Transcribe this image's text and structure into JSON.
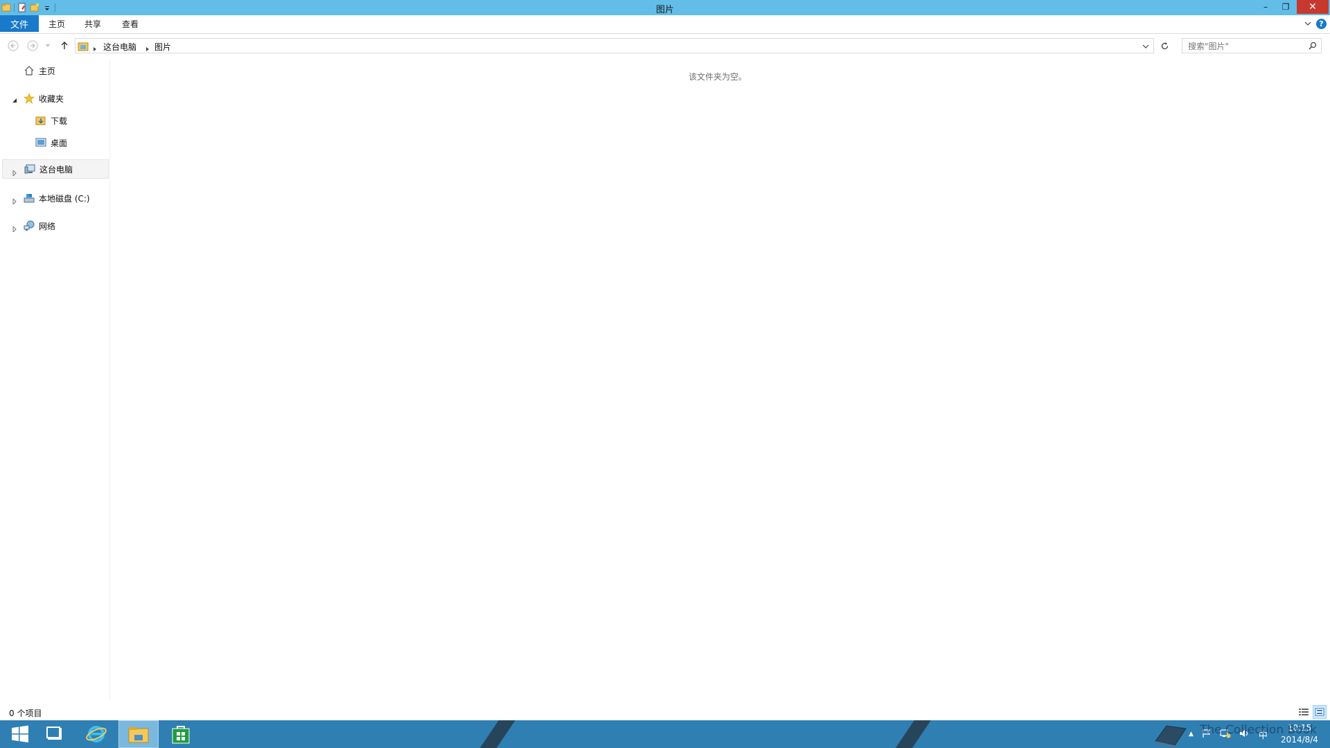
{
  "window": {
    "title": "图片",
    "minimize_glyph": "–",
    "restore_glyph": "❐",
    "close_glyph": "✕"
  },
  "ribbon": {
    "tabs": [
      {
        "label": "文件"
      },
      {
        "label": "主页"
      },
      {
        "label": "共享"
      },
      {
        "label": "查看"
      }
    ],
    "help_glyph": "?"
  },
  "address": {
    "breadcrumbs": [
      "这台电脑",
      "图片"
    ]
  },
  "search": {
    "placeholder": "搜索\"图片\""
  },
  "nav": {
    "home": "主页",
    "favorites": "收藏夹",
    "downloads": "下载",
    "desktop": "桌面",
    "this_pc": "这台电脑",
    "local_disk": "本地磁盘 (C:)",
    "network": "网络"
  },
  "content": {
    "empty_message": "该文件夹为空。"
  },
  "status": {
    "item_count": "0 个项目"
  },
  "taskbar": {
    "time": "10:15",
    "date": "2014/8/4",
    "ime": "中",
    "tray_up_glyph": "▲"
  },
  "watermark": {
    "text": "The Collection Book"
  },
  "colors": {
    "titlebar": "#62bde9",
    "file_tab": "#1979ca",
    "close_button": "#c7392f",
    "taskbar": "#2f7fb3"
  }
}
